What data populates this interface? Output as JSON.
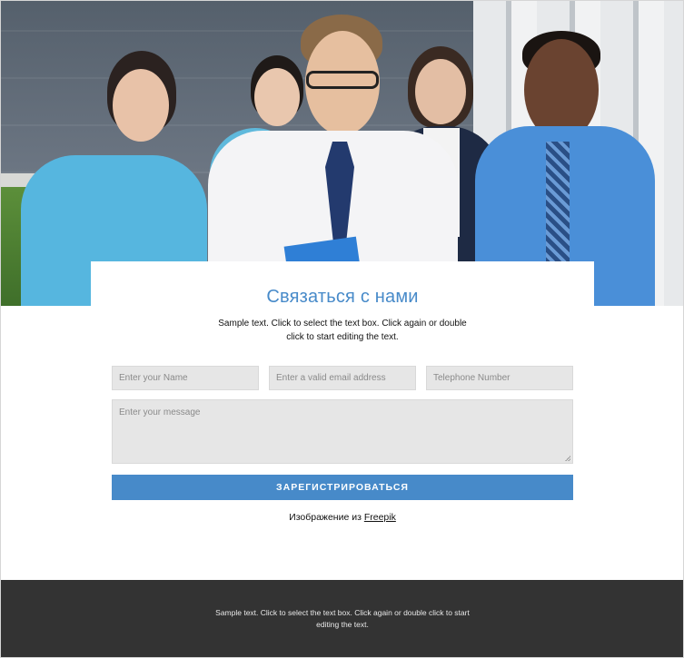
{
  "contact": {
    "title": "Связаться с нами",
    "subtitle": "Sample text. Click to select the text box. Click again or double click to start editing the text.",
    "form": {
      "name_placeholder": "Enter your Name",
      "email_placeholder": "Enter a valid email address",
      "phone_placeholder": "Telephone Number",
      "message_placeholder": "Enter your message",
      "submit_label": "ЗАРЕГИСТРИРОВАТЬСЯ"
    },
    "credit_prefix": "Изображение из",
    "credit_link": "Freepik"
  },
  "footer": {
    "text": "Sample text. Click to select the text box. Click again or double click to start editing the text."
  },
  "colors": {
    "accent": "#478ac9",
    "footer_bg": "#333333",
    "field_bg": "#e6e6e6"
  }
}
